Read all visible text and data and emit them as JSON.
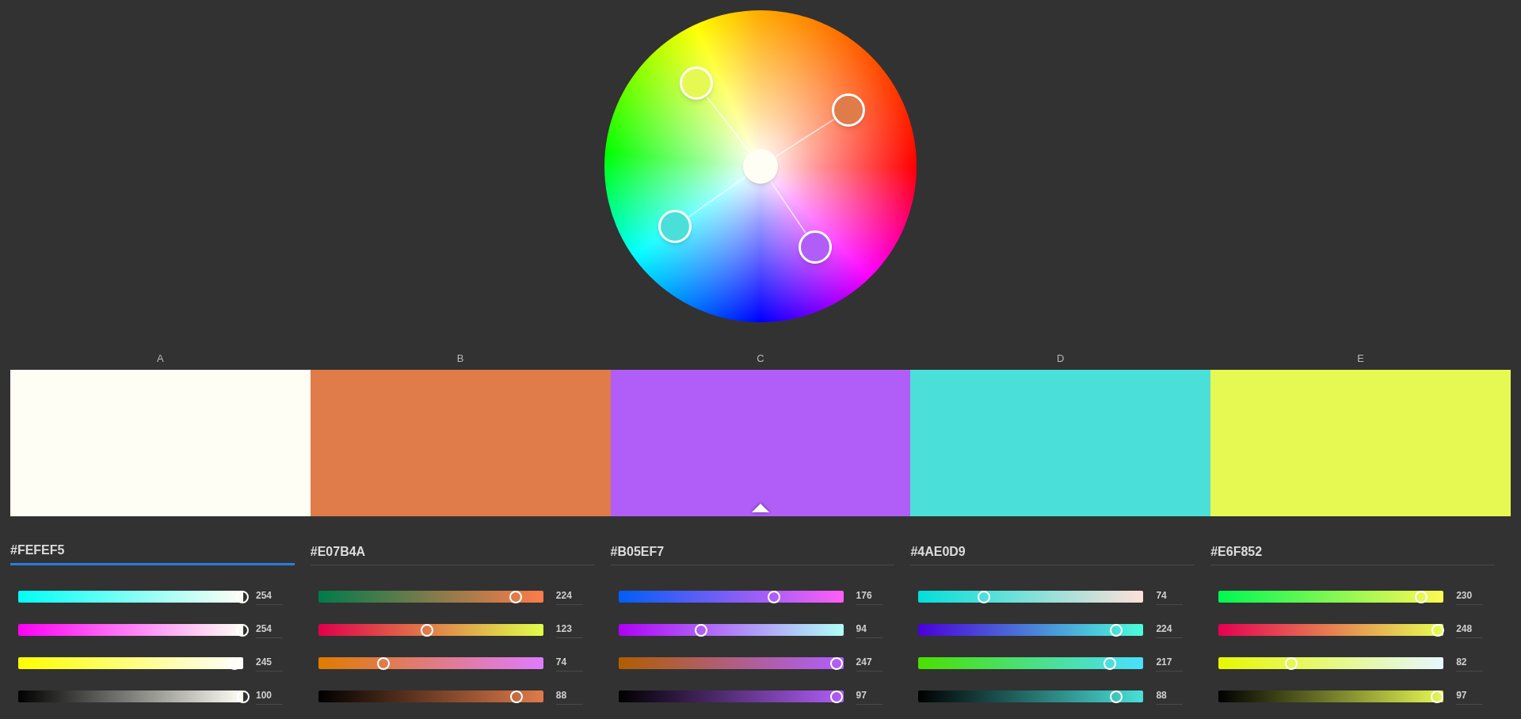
{
  "swatches": [
    {
      "label": "A",
      "color": "#fefef5",
      "selected": false,
      "hex": "#FEFEF5",
      "focused": true,
      "sliders": [
        {
          "kind": "red",
          "level": 0.996,
          "reading": "254"
        },
        {
          "kind": "green",
          "level": 0.996,
          "reading": "254"
        },
        {
          "kind": "blue",
          "level": 0.961,
          "reading": "245"
        },
        {
          "kind": "brightness",
          "level": 1.0,
          "reading": "100"
        }
      ]
    },
    {
      "label": "B",
      "color": "#e07b4a",
      "selected": false,
      "hex": "#E07B4A",
      "focused": false,
      "sliders": [
        {
          "kind": "red",
          "level": 0.878,
          "reading": "224"
        },
        {
          "kind": "green",
          "level": 0.482,
          "reading": "123"
        },
        {
          "kind": "blue",
          "level": 0.29,
          "reading": "74"
        },
        {
          "kind": "brightness",
          "level": 0.88,
          "reading": "88"
        }
      ]
    },
    {
      "label": "C",
      "color": "#b05ef7",
      "selected": true,
      "hex": "#B05EF7",
      "focused": false,
      "sliders": [
        {
          "kind": "red",
          "level": 0.69,
          "reading": "176"
        },
        {
          "kind": "green",
          "level": 0.369,
          "reading": "94"
        },
        {
          "kind": "blue",
          "level": 0.969,
          "reading": "247"
        },
        {
          "kind": "brightness",
          "level": 0.97,
          "reading": "97"
        }
      ]
    },
    {
      "label": "D",
      "color": "#4ae0d9",
      "selected": false,
      "hex": "#4AE0D9",
      "focused": false,
      "sliders": [
        {
          "kind": "red",
          "level": 0.29,
          "reading": "74"
        },
        {
          "kind": "green",
          "level": 0.878,
          "reading": "224"
        },
        {
          "kind": "blue",
          "level": 0.851,
          "reading": "217"
        },
        {
          "kind": "brightness",
          "level": 0.88,
          "reading": "88"
        }
      ]
    },
    {
      "label": "E",
      "color": "#e6f852",
      "selected": false,
      "hex": "#E6F852",
      "focused": false,
      "sliders": [
        {
          "kind": "red",
          "level": 0.902,
          "reading": "230"
        },
        {
          "kind": "green",
          "level": 0.973,
          "reading": "248"
        },
        {
          "kind": "blue",
          "level": 0.322,
          "reading": "82"
        },
        {
          "kind": "brightness",
          "level": 0.97,
          "reading": "97"
        }
      ]
    }
  ]
}
